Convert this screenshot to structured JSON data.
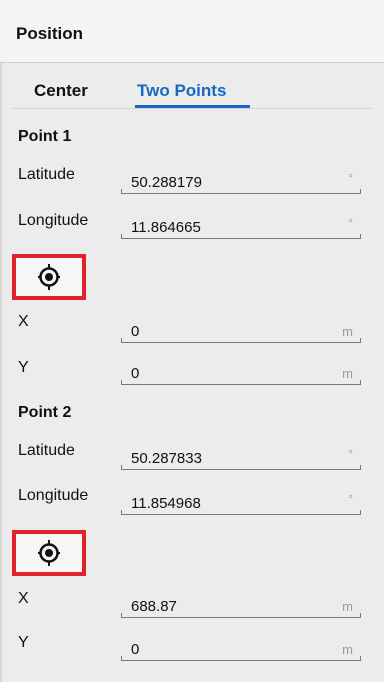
{
  "panel": {
    "title": "Position"
  },
  "tabs": [
    {
      "label": "Center",
      "active": false
    },
    {
      "label": "Two Points",
      "active": true
    }
  ],
  "accent_color": "#1668c4",
  "highlight_color": "#e0232c",
  "points": [
    {
      "title": "Point 1",
      "latitude": {
        "label": "Latitude",
        "value": "50.288179",
        "unit": "°"
      },
      "longitude": {
        "label": "Longitude",
        "value": "11.864665",
        "unit": "°"
      },
      "locate_icon": "crosshair-target-icon",
      "x": {
        "label": "X",
        "value": "0",
        "unit": "m"
      },
      "y": {
        "label": "Y",
        "value": "0",
        "unit": "m"
      }
    },
    {
      "title": "Point 2",
      "latitude": {
        "label": "Latitude",
        "value": "50.287833",
        "unit": "°"
      },
      "longitude": {
        "label": "Longitude",
        "value": "11.854968",
        "unit": "°"
      },
      "locate_icon": "crosshair-target-icon",
      "x": {
        "label": "X",
        "value": "688.87",
        "unit": "m"
      },
      "y": {
        "label": "Y",
        "value": "0",
        "unit": "m"
      }
    }
  ]
}
